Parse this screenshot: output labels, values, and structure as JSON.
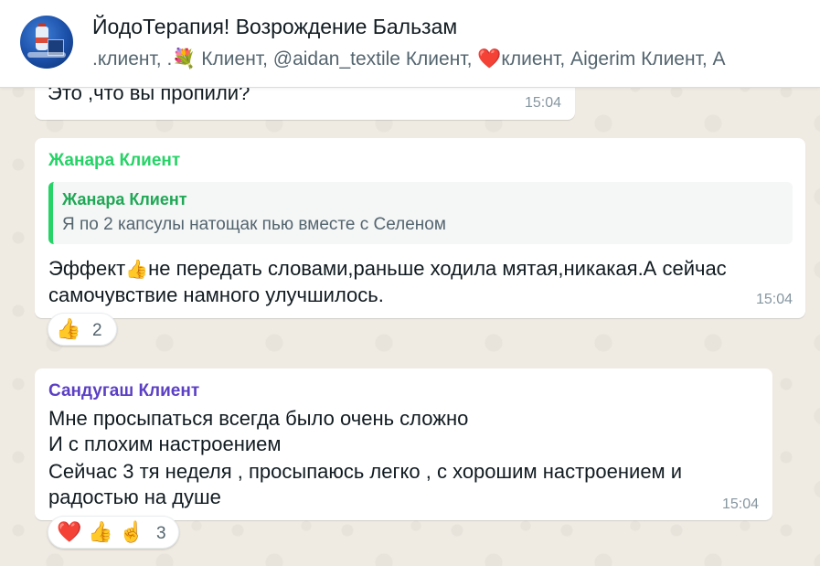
{
  "header": {
    "title": "ЙодоТерапия! Возрождение Бальзам",
    "participants": ".клиент, .💐 Клиент, @aidan_textile Клиент, ❤️клиент, Aigerim Клиент, A"
  },
  "messages": [
    {
      "text_lines": [
        "Это ,что вы пропили?"
      ],
      "time": "15:04"
    },
    {
      "sender": "Жанара Клиент",
      "sender_color": "#25d366",
      "quote": {
        "sender": "Жанара Клиент",
        "text": "Я по 2 капсулы натощак пью вместе с Селеном"
      },
      "text_lines": [
        {
          "before": "Эффект",
          "emoji": "👍",
          "after": "не передать словами,раньше ходила мятая,никакая.А сейчас"
        },
        "самочувствие намного улучшилось."
      ],
      "time": "15:04",
      "reactions": {
        "emojis": [
          "👍"
        ],
        "count": "2"
      }
    },
    {
      "sender": "Сандугаш Клиент",
      "sender_color": "#5b3fc4",
      "text_lines": [
        "Мне просыпаться всегда было очень сложно",
        "И с плохим настроением",
        "Сейчас 3 тя неделя , просыпаюсь легко , с хорошим настроением и",
        "радостью на душе"
      ],
      "time": "15:04",
      "reactions": {
        "emojis": [
          "❤️",
          "👍",
          "☝️"
        ],
        "count": "3"
      }
    }
  ]
}
